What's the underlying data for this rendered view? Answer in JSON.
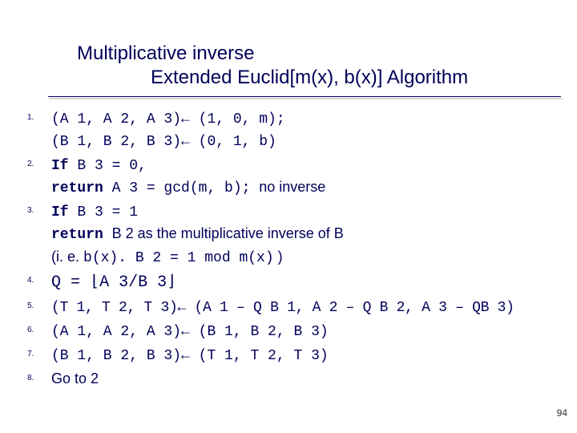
{
  "title": {
    "line1": "Multiplicative inverse",
    "line2": "Extended Euclid[m(x), b(x)] Algorithm"
  },
  "steps": {
    "n1": "1.",
    "s1a": "(A 1, A 2, A 3)",
    "arrow": "←",
    "s1b": " (1, 0, m);",
    "s1c": "(B 1, B 2, B 3)",
    "s1d": " (0, 1, b)",
    "n2": "2.",
    "s2if": "If ",
    "s2a": "B 3 = 0,",
    "s2ret": "return ",
    "s2b": "A 3 = gcd(m, b); ",
    "s2noinv": "no inverse",
    "n3": "3.",
    "s3if": "If ",
    "s3a": "B 3 = 1",
    "s3ret": "return ",
    "s3b": " B 2 as the multiplicative inverse of B",
    "s3ie": "(i. e.    ",
    "s3c": "b(x). B 2 = 1 mod m(x)",
    "s3close": "    )",
    "n4": "4.",
    "s4a": "Q = ",
    "s4floorL": "⌊",
    "s4b": "A 3/B 3",
    "s4floorR": "⌋",
    "n5": "5.",
    "s5a": "(T 1, T 2, T 3)",
    "s5b": " (A 1 – Q B 1, A 2 – Q B 2, A 3 – QB 3)",
    "n6": "6.",
    "s6a": "(A 1, A 2, A 3)",
    "s6b": " (B 1, B 2, B 3)",
    "n7": "7.",
    "s7a": "(B 1, B 2, B 3)",
    "s7b": " (T 1, T 2, T 3)",
    "n8": "8.",
    "s8": "Go to 2"
  },
  "page": "94"
}
